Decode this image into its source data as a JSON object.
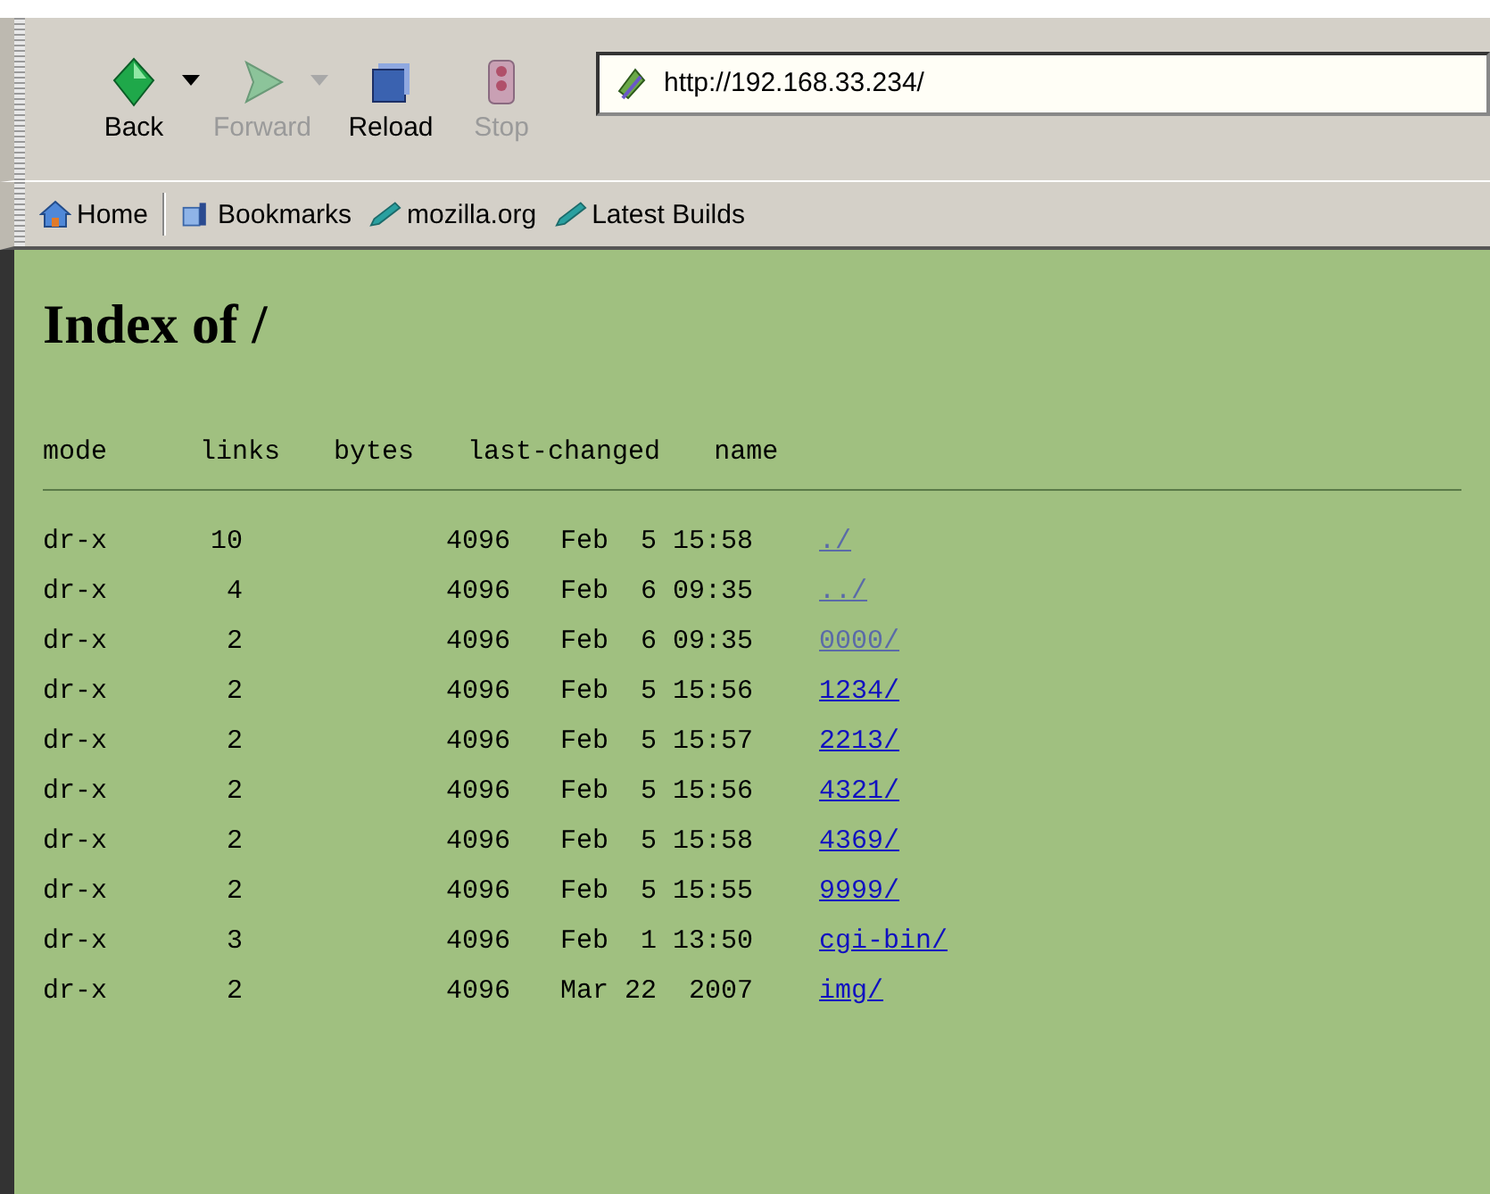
{
  "toolbar": {
    "buttons": [
      {
        "label": "Back",
        "kind": "back",
        "disabled": false,
        "dropdown": true
      },
      {
        "label": "Forward",
        "kind": "forward",
        "disabled": true,
        "dropdown": true
      },
      {
        "label": "Reload",
        "kind": "reload",
        "disabled": false,
        "dropdown": false
      },
      {
        "label": "Stop",
        "kind": "stop",
        "disabled": true,
        "dropdown": false
      }
    ],
    "address": "http://192.168.33.234/"
  },
  "bookmarks": [
    {
      "label": "Home",
      "kind": "home"
    },
    {
      "label": "Bookmarks",
      "kind": "bookmarks"
    },
    {
      "label": "mozilla.org",
      "kind": "link"
    },
    {
      "label": "Latest Builds",
      "kind": "link"
    }
  ],
  "page": {
    "title": "Index of /",
    "columns": [
      "mode",
      "links",
      "bytes",
      "last-changed",
      "name"
    ],
    "rows": [
      {
        "mode": "dr-x",
        "links": "10",
        "bytes": "4096",
        "changed": "Feb  5 15:58",
        "name": "./",
        "visited": true
      },
      {
        "mode": "dr-x",
        "links": "4",
        "bytes": "4096",
        "changed": "Feb  6 09:35",
        "name": "../",
        "visited": true
      },
      {
        "mode": "dr-x",
        "links": "2",
        "bytes": "4096",
        "changed": "Feb  6 09:35",
        "name": "0000/",
        "visited": true
      },
      {
        "mode": "dr-x",
        "links": "2",
        "bytes": "4096",
        "changed": "Feb  5 15:56",
        "name": "1234/",
        "visited": false
      },
      {
        "mode": "dr-x",
        "links": "2",
        "bytes": "4096",
        "changed": "Feb  5 15:57",
        "name": "2213/",
        "visited": false
      },
      {
        "mode": "dr-x",
        "links": "2",
        "bytes": "4096",
        "changed": "Feb  5 15:56",
        "name": "4321/",
        "visited": false
      },
      {
        "mode": "dr-x",
        "links": "2",
        "bytes": "4096",
        "changed": "Feb  5 15:58",
        "name": "4369/",
        "visited": false
      },
      {
        "mode": "dr-x",
        "links": "2",
        "bytes": "4096",
        "changed": "Feb  5 15:55",
        "name": "9999/",
        "visited": false
      },
      {
        "mode": "dr-x",
        "links": "3",
        "bytes": "4096",
        "changed": "Feb  1 13:50",
        "name": "cgi-bin/",
        "visited": false
      },
      {
        "mode": "dr-x",
        "links": "2",
        "bytes": "4096",
        "changed": "Mar 22  2007",
        "name": "img/",
        "visited": false
      }
    ]
  }
}
